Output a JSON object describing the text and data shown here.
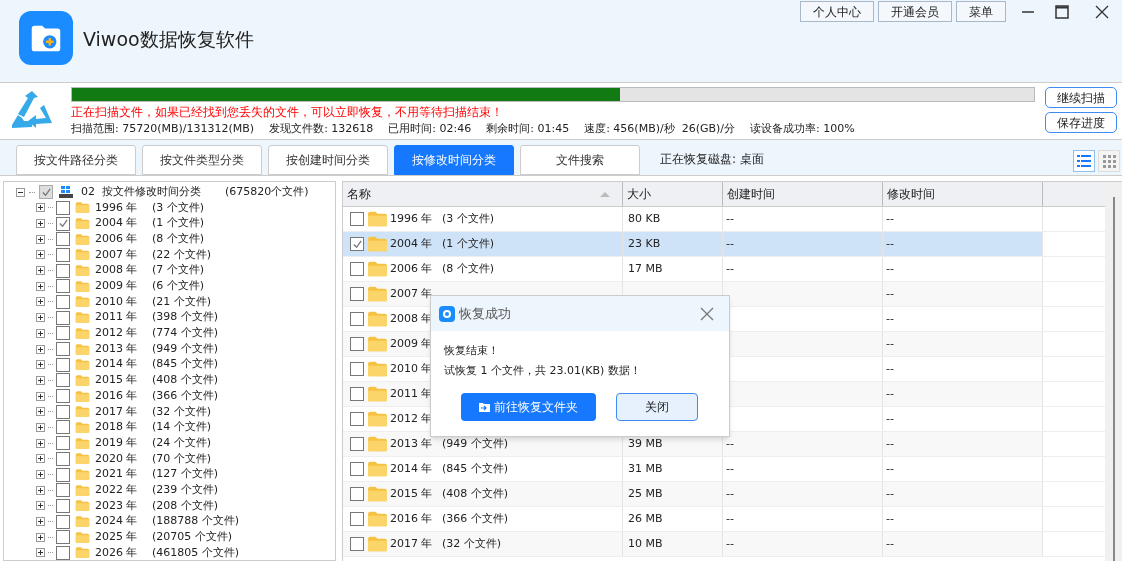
{
  "app": {
    "title": "Viwoo数据恢复软件"
  },
  "top_buttons": [
    "个人中心",
    "开通会员",
    "菜单"
  ],
  "scan": {
    "level": 0.57,
    "message": "正在扫描文件，如果已经找到您丢失的文件，可以立即恢复，不用等待扫描结束！",
    "stats": [
      "扫描范围: 75720(MB)/131312(MB)",
      "发现文件数: 132618",
      "已用时间: 02:46",
      "剩余时间: 01:45",
      "速度: 456(MB)/秒  26(GB)/分",
      "读设备成功率: 100%"
    ],
    "buttons": [
      "继续扫描",
      "保存进度"
    ]
  },
  "tabs": [
    {
      "label": "按文件路径分类",
      "selected": false
    },
    {
      "label": "按文件类型分类",
      "selected": false
    },
    {
      "label": "按创建时间分类",
      "selected": false
    },
    {
      "label": "按修改时间分类",
      "selected": true
    },
    {
      "label": "文件搜索",
      "selected": false
    }
  ],
  "disk_label": "正在恢复磁盘: 桌面",
  "view_modes": [
    {
      "kind": "list",
      "selected": true
    },
    {
      "kind": "grid",
      "selected": false
    }
  ],
  "tree": {
    "label": "02  按文件修改时间分类",
    "count": "(675820个文件)",
    "checked": true,
    "expanded": true,
    "children": [
      {
        "label": "1996 年",
        "count": "(3 个文件)",
        "checked": false
      },
      {
        "label": "2004 年",
        "count": "(1 个文件)",
        "checked": true
      },
      {
        "label": "2006 年",
        "count": "(8 个文件)",
        "checked": false
      },
      {
        "label": "2007 年",
        "count": "(22 个文件)",
        "checked": false
      },
      {
        "label": "2008 年",
        "count": "(7 个文件)",
        "checked": false
      },
      {
        "label": "2009 年",
        "count": "(6 个文件)",
        "checked": false
      },
      {
        "label": "2010 年",
        "count": "(21 个文件)",
        "checked": false
      },
      {
        "label": "2011 年",
        "count": "(398 个文件)",
        "checked": false
      },
      {
        "label": "2012 年",
        "count": "(774 个文件)",
        "checked": false
      },
      {
        "label": "2013 年",
        "count": "(949 个文件)",
        "checked": false
      },
      {
        "label": "2014 年",
        "count": "(845 个文件)",
        "checked": false
      },
      {
        "label": "2015 年",
        "count": "(408 个文件)",
        "checked": false
      },
      {
        "label": "2016 年",
        "count": "(366 个文件)",
        "checked": false
      },
      {
        "label": "2017 年",
        "count": "(32 个文件)",
        "checked": false
      },
      {
        "label": "2018 年",
        "count": "(14 个文件)",
        "checked": false
      },
      {
        "label": "2019 年",
        "count": "(24 个文件)",
        "checked": false
      },
      {
        "label": "2020 年",
        "count": "(70 个文件)",
        "checked": false
      },
      {
        "label": "2021 年",
        "count": "(127 个文件)",
        "checked": false
      },
      {
        "label": "2022 年",
        "count": "(239 个文件)",
        "checked": false
      },
      {
        "label": "2023 年",
        "count": "(208 个文件)",
        "checked": false
      },
      {
        "label": "2024 年",
        "count": "(188788 个文件)",
        "checked": false
      },
      {
        "label": "2025 年",
        "count": "(20705 个文件)",
        "checked": false
      },
      {
        "label": "2026 年",
        "count": "(461805 个文件)",
        "checked": false
      }
    ]
  },
  "table": {
    "columns": [
      "名称",
      "大小",
      "创建时间",
      "修改时间"
    ],
    "rows": [
      {
        "name": "1996 年",
        "count": "(3 个文件)",
        "size": "80 KB",
        "created": "--",
        "modified": "--",
        "checked": false,
        "selected": false
      },
      {
        "name": "2004 年",
        "count": "(1 个文件)",
        "size": "23 KB",
        "created": "--",
        "modified": "--",
        "checked": true,
        "selected": true
      },
      {
        "name": "2006 年",
        "count": "(8 个文件)",
        "size": "17 MB",
        "created": "--",
        "modified": "--",
        "checked": false,
        "selected": false
      },
      {
        "name": "2007 年",
        "modified": "--",
        "checked": false,
        "selected": false
      },
      {
        "name": "2008 年",
        "modified": "--",
        "checked": false,
        "selected": false
      },
      {
        "name": "2009 年",
        "modified": "--",
        "checked": false,
        "selected": false
      },
      {
        "name": "2010 年",
        "modified": "--",
        "checked": false,
        "selected": false
      },
      {
        "name": "2011 年",
        "modified": "--",
        "checked": false,
        "selected": false
      },
      {
        "name": "2012 年",
        "modified": "--",
        "checked": false,
        "selected": false
      },
      {
        "name": "2013 年",
        "count": "(949 个文件)",
        "size": "39 MB",
        "created": "--",
        "modified": "--",
        "checked": false,
        "selected": false
      },
      {
        "name": "2014 年",
        "count": "(845 个文件)",
        "size": "31 MB",
        "created": "--",
        "modified": "--",
        "checked": false,
        "selected": false
      },
      {
        "name": "2015 年",
        "count": "(408 个文件)",
        "size": "25 MB",
        "created": "--",
        "modified": "--",
        "checked": false,
        "selected": false
      },
      {
        "name": "2016 年",
        "count": "(366 个文件)",
        "size": "26 MB",
        "created": "--",
        "modified": "--",
        "checked": false,
        "selected": false
      },
      {
        "name": "2017 年",
        "count": "(32 个文件)",
        "size": "10 MB",
        "created": "--",
        "modified": "--",
        "checked": false,
        "selected": false
      }
    ]
  },
  "dialog": {
    "title": "恢复成功",
    "lines": [
      "恢复结束！",
      "试恢复 1 个文件，共 23.01(KB) 数据！"
    ],
    "primary": "前往恢复文件夹",
    "secondary": "关闭"
  }
}
